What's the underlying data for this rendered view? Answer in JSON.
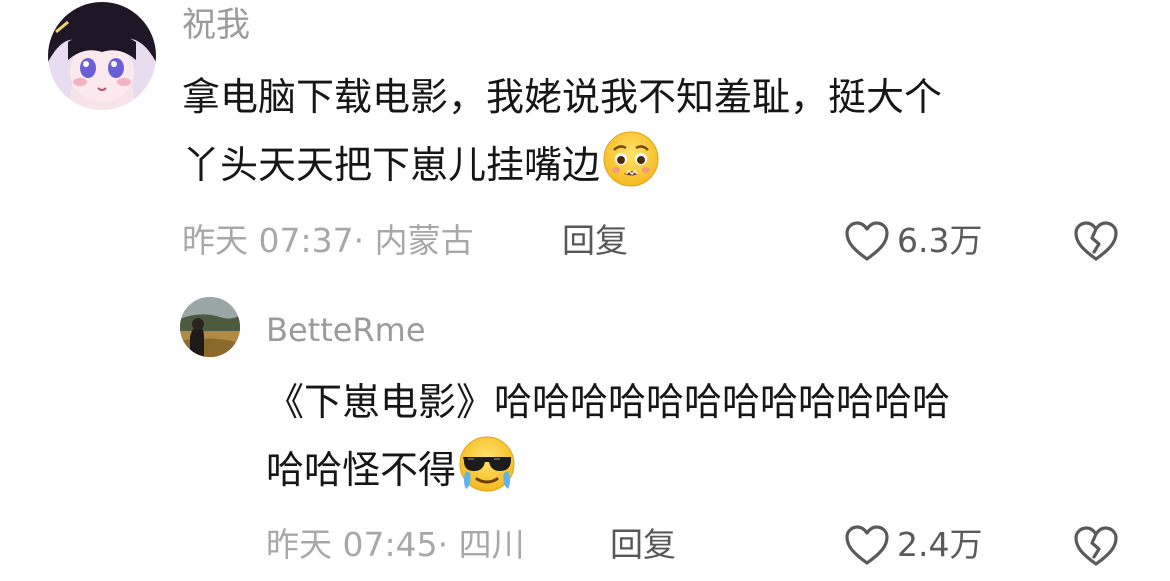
{
  "comments": [
    {
      "username": "祝我",
      "avatar": "anime-girl-avatar",
      "content_lines": [
        "拿电脑下载电影，我姥说我不知羞耻，挺大个",
        "丫头天天把下崽儿挂嘴边"
      ],
      "emoji": "pleading-face",
      "time_location": "昨天 07:37· 内蒙古",
      "reply_label": "回复",
      "like_count": "6.3万"
    },
    {
      "username": "BetteRme",
      "avatar": "landscape-person-avatar",
      "content_lines": [
        "《下崽电影》哈哈哈哈哈哈哈哈哈哈哈哈",
        "哈哈怪不得"
      ],
      "emoji": "sunglasses-tears-face",
      "time_location": "昨天 07:45· 四川",
      "reply_label": "回复",
      "like_count": "2.4万"
    }
  ],
  "colors": {
    "text": "#161616",
    "muted": "#a8a8a8",
    "username": "#9b9b9b",
    "action": "#585858"
  }
}
